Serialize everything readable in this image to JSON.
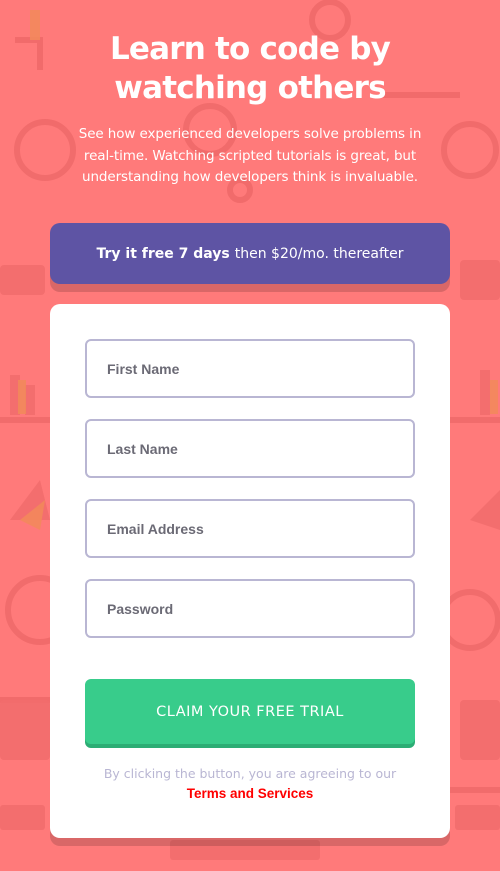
{
  "hero": {
    "title_line1": "Learn to code by",
    "title_line2": "watching others",
    "text_line1": "See how experienced developers solve problems in",
    "text_line2": "real-time. Watching scripted tutorials is great, but",
    "text_line3": "understanding how developers think is invaluable."
  },
  "offer": {
    "bold": "Try it free 7 days",
    "rest": "then $20/mo. thereafter"
  },
  "form": {
    "first_name_placeholder": "First Name",
    "last_name_placeholder": "Last Name",
    "email_placeholder": "Email Address",
    "password_placeholder": "Password",
    "submit_label": "CLAIM YOUR FREE TRIAL",
    "terms_text": "By clicking the button, you are agreeing to our",
    "terms_link": "Terms and Services"
  },
  "colors": {
    "background": "#ff7a7a",
    "banner": "#5e54a4",
    "button": "#38cc8b",
    "field_border": "#b9b6d3",
    "terms_link": "#ff0000"
  }
}
